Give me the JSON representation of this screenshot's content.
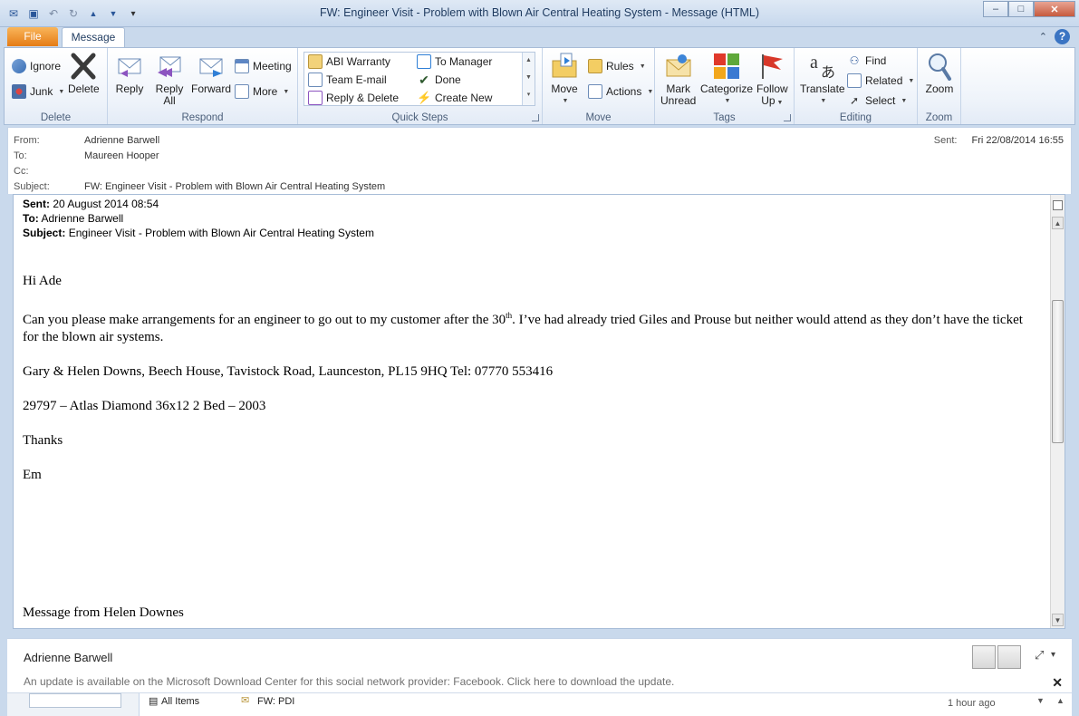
{
  "window": {
    "title": "FW: Engineer Visit - Problem with Blown Air Central Heating System  -  Message (HTML)",
    "controls": {
      "minimize": "–",
      "maximize": "□",
      "close": "✕"
    }
  },
  "quick_access": [
    {
      "icon": "mail-icon",
      "glyph": "✉"
    },
    {
      "icon": "save-icon",
      "glyph": "▣"
    },
    {
      "icon": "undo-icon",
      "glyph": "↶"
    },
    {
      "icon": "redo-icon",
      "glyph": "↻"
    },
    {
      "icon": "up-arrow-icon",
      "glyph": "▲"
    },
    {
      "icon": "down-arrow-icon",
      "glyph": "▼"
    },
    {
      "icon": "customize-icon",
      "glyph": "▾"
    }
  ],
  "tabs": {
    "file": "File",
    "message": "Message"
  },
  "ribbon": {
    "delete": {
      "label": "Delete",
      "ignore": "Ignore",
      "junk": "Junk",
      "delete_btn": "Delete"
    },
    "respond": {
      "label": "Respond",
      "reply": "Reply",
      "reply_all_1": "Reply",
      "reply_all_2": "All",
      "forward": "Forward",
      "meeting": "Meeting",
      "more": "More"
    },
    "quick_steps": {
      "label": "Quick Steps",
      "items": [
        "ABI Warranty",
        "Team E-mail",
        "Reply & Delete",
        "To Manager",
        "Done",
        "Create New"
      ]
    },
    "move": {
      "label": "Move",
      "move_btn": "Move",
      "rules": "Rules",
      "actions": "Actions"
    },
    "tags": {
      "label": "Tags",
      "mark_unread_1": "Mark",
      "mark_unread_2": "Unread",
      "categorize": "Categorize",
      "follow_up_1": "Follow",
      "follow_up_2": "Up"
    },
    "editing": {
      "label": "Editing",
      "translate": "Translate",
      "find": "Find",
      "related": "Related",
      "select": "Select"
    },
    "zoom": {
      "label": "Zoom",
      "zoom_btn": "Zoom"
    }
  },
  "header": {
    "from_label": "From:",
    "from": "Adrienne Barwell",
    "to_label": "To:",
    "to": "Maureen Hooper",
    "cc_label": "Cc:",
    "cc": "",
    "subject_label": "Subject:",
    "subject": "FW: Engineer Visit - Problem with Blown Air Central Heating System",
    "sent_label": "Sent:",
    "sent": "Fri 22/08/2014 16:55"
  },
  "body": {
    "fwd_sent_label": "Sent:",
    "fwd_sent": "20 August 2014 08:54",
    "fwd_to_label": "To:",
    "fwd_to": "Adrienne Barwell",
    "fwd_subject_label": "Subject:",
    "fwd_subject": "Engineer Visit - Problem with Blown Air Central Heating System",
    "greeting": "Hi Ade",
    "para1_a": "Can you please make arrangements for an engineer to go out to my customer after the 30",
    "para1_sup": "th",
    "para1_b": ". I’ve had already tried Giles and Prouse but neither would attend as they don’t have the ticket for the blown air systems.",
    "address": "Gary & Helen Downs, Beech House, Tavistock Road, Launceston, PL15 9HQ  Tel: 07770 553416",
    "model": "29797 – Atlas Diamond 36x12 2 Bed – 2003",
    "thanks": "Thanks",
    "signoff": "Em",
    "footer": "Message from Helen Downes"
  },
  "people_pane": {
    "name": "Adrienne Barwell",
    "update_notice": "An update is available on the Microsoft Download Center for this social network provider: Facebook. Click here to download the update.",
    "all_items": "All Items",
    "item_subject": "FW: PDI",
    "item_time": "1 hour ago"
  },
  "colors": {
    "file_tab": "#e57c16",
    "accent": "#2a5699",
    "ribbon_border": "#a7bcd7"
  }
}
